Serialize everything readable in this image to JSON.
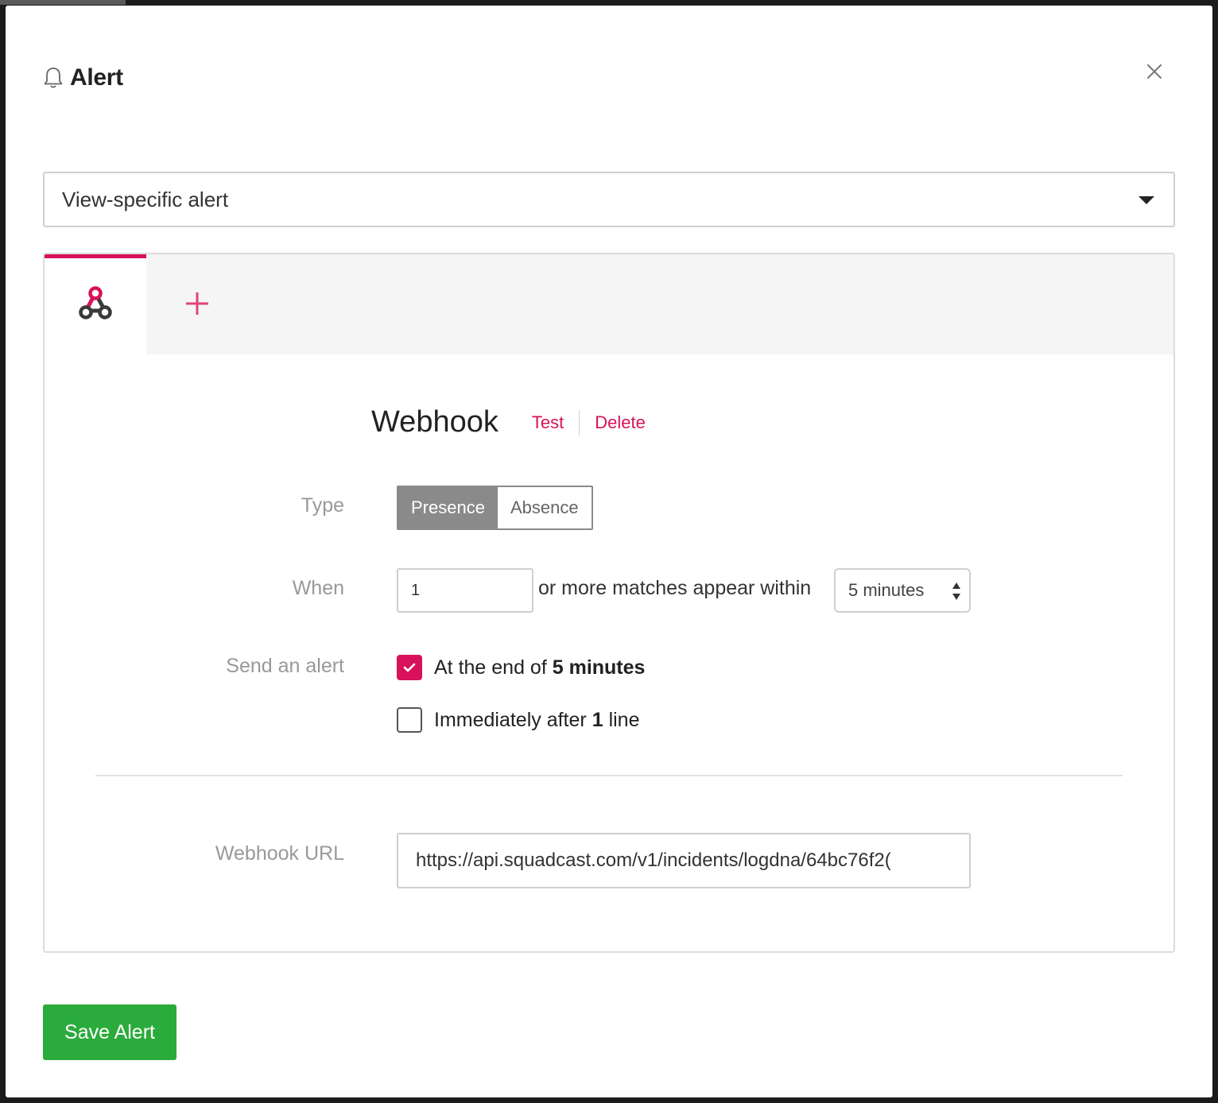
{
  "modal": {
    "title": "Alert",
    "title_icon": "bell-icon",
    "close_icon": "close-icon"
  },
  "alert_scope": {
    "selected": "View-specific alert",
    "caret_icon": "caret-down-icon"
  },
  "channel_tabs": [
    {
      "icon": "webhook-icon",
      "active": true
    },
    {
      "icon": "plus-icon",
      "active": false
    }
  ],
  "channel": {
    "title": "Webhook",
    "test_label": "Test",
    "delete_label": "Delete"
  },
  "form": {
    "type_label": "Type",
    "type_options": [
      "Presence",
      "Absence"
    ],
    "type_selected": "Presence",
    "when_label": "When",
    "match_count": "1",
    "when_text": "or more matches appear within",
    "window_selected": "5 minutes",
    "send_label": "Send an alert",
    "send_options": {
      "end_prefix": "At the end of",
      "end_bold": "5 minutes",
      "end_checked": true,
      "immediate_prefix": "Immediately after",
      "immediate_bold": "1",
      "immediate_suffix": "line",
      "immediate_checked": false
    },
    "url_label": "Webhook URL",
    "url_value": "https://api.squadcast.com/v1/incidents/logdna/64bc76f2("
  },
  "footer": {
    "save_label": "Save Alert"
  },
  "colors": {
    "accent": "#d8125a",
    "save": "#2bab3b",
    "segment_active": "#8a8a8a"
  }
}
